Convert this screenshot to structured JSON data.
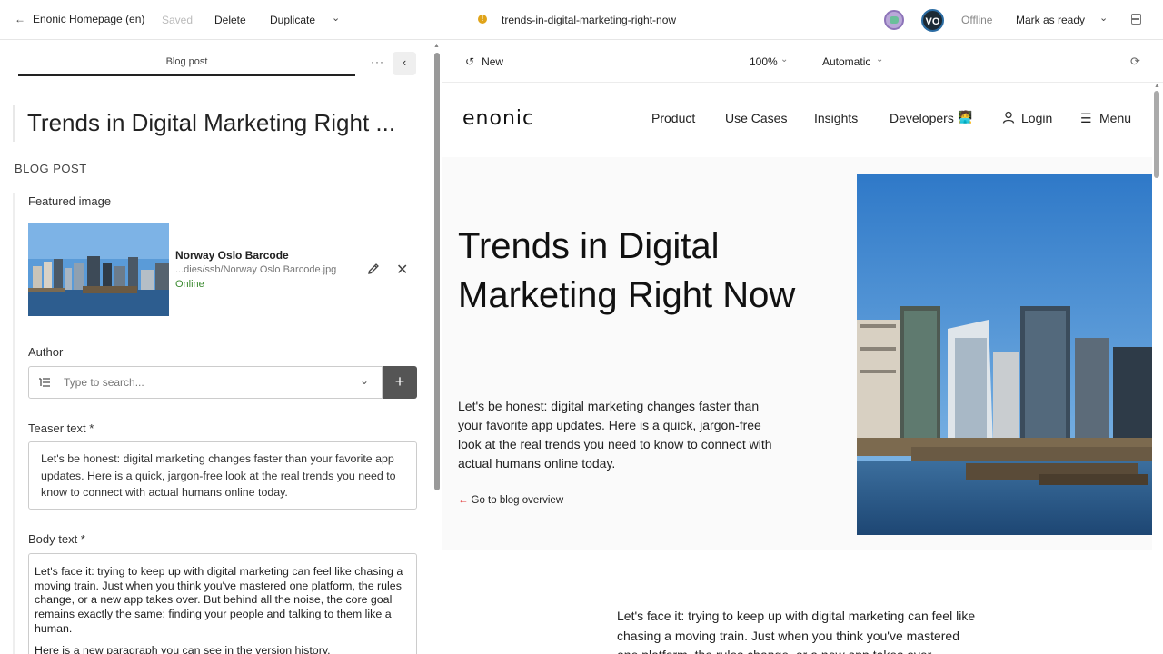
{
  "topbar": {
    "back_label": "Enonic Homepage (en)",
    "saved_label": "Saved",
    "delete_label": "Delete",
    "duplicate_label": "Duplicate",
    "content_path": "trends-in-digital-marketing-right-now",
    "avatar_initials": "VO",
    "status": "Offline",
    "mark_ready_label": "Mark as ready"
  },
  "left_panel": {
    "tab_label": "Blog post",
    "more_label": "···",
    "title": "Trends in Digital Marketing Right ...",
    "section": "BLOG POST",
    "featured_image": {
      "label": "Featured image",
      "name": "Norway Oslo Barcode",
      "path": "...dies/ssb/Norway Oslo Barcode.jpg",
      "status": "Online"
    },
    "author": {
      "label": "Author",
      "placeholder": "Type to search..."
    },
    "teaser": {
      "label": "Teaser text *",
      "text": "Let's be honest: digital marketing changes faster than your favorite app updates. Here is a quick, jargon-free look at the real trends you need to know to connect with actual humans online today."
    },
    "body": {
      "label": "Body text *",
      "paragraph1": "Let's face it: trying to keep up with digital marketing can feel like chasing a moving train. Just when you think you've mastered one platform, the rules change, or a new app takes over. But behind all the noise, the core goal remains exactly the same: finding your people and talking to them like a human.",
      "paragraph2": "Here is a new paragraph you can see in the version history."
    }
  },
  "preview": {
    "version_label": "New",
    "zoom": "100%",
    "mode": "Automatic",
    "site": {
      "logo": "enonic",
      "nav": [
        "Product",
        "Use Cases",
        "Insights",
        "Developers",
        "Login",
        "Menu"
      ],
      "hero_title": "Trends in Digital Marketing Right Now",
      "hero_text": "Let's be honest: digital marketing changes faster than your favorite app updates. Here is a quick, jargon-free look at the real trends you need to know to connect with actual humans online today.",
      "back_link": "Go to blog overview",
      "body_text": "Let's face it: trying to keep up with digital marketing can feel like chasing a moving train. Just when you think you've mastered one platform, the rules change, or a new app takes over."
    }
  },
  "colors": {
    "accent_warning": "#e0a419",
    "online_green": "#3a8a2f",
    "link_arrow_red": "#e23b3b"
  }
}
